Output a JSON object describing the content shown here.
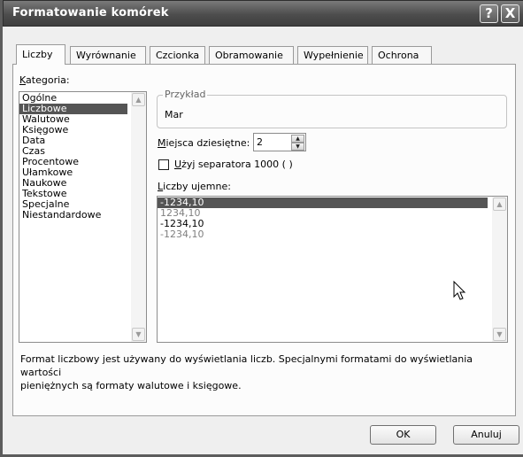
{
  "window": {
    "title": "Formatowanie komórek",
    "help_glyph": "?",
    "close_glyph": "X"
  },
  "tabs": [
    {
      "label": "Liczby",
      "active": true
    },
    {
      "label": "Wyrównanie"
    },
    {
      "label": "Czcionka"
    },
    {
      "label": "Obramowanie"
    },
    {
      "label": "Wypełnienie"
    },
    {
      "label": "Ochrona"
    }
  ],
  "category": {
    "label_first": "K",
    "label_rest": "ategoria:",
    "items": [
      "Ogólne",
      "Liczbowe",
      "Walutowe",
      "Księgowe",
      "Data",
      "Czas",
      "Procentowe",
      "Ułamkowe",
      "Naukowe",
      "Tekstowe",
      "Specjalne",
      "Niestandardowe"
    ],
    "selected": "Liczbowe"
  },
  "sample": {
    "caption": "Przykład",
    "value": "Mar"
  },
  "decimal": {
    "label_first": "M",
    "label_rest": "iejsca dziesiętne:",
    "value": "2"
  },
  "separator": {
    "label_first": "U",
    "label_rest": "żyj separatora 1000 ( )",
    "checked": false
  },
  "negative": {
    "label_first": "L",
    "label_rest": "iczby ujemne:",
    "items": [
      {
        "text": "-1234,10",
        "color": "#ffffff",
        "selected": true
      },
      {
        "text": "1234,10",
        "color": "#808080"
      },
      {
        "text": "-1234,10",
        "color": "#000000"
      },
      {
        "text": "-1234,10",
        "color": "#808080"
      }
    ]
  },
  "description": {
    "line1": "Format liczbowy jest używany do wyświetlania liczb. Specjalnymi formatami do wyświetlania wartości",
    "line2": "pieniężnych są formaty walutowe i księgowe."
  },
  "buttons": {
    "ok": "OK",
    "cancel": "Anuluj"
  },
  "colors": {
    "selection": "#555555",
    "titlebar": "#4d4d4d"
  }
}
